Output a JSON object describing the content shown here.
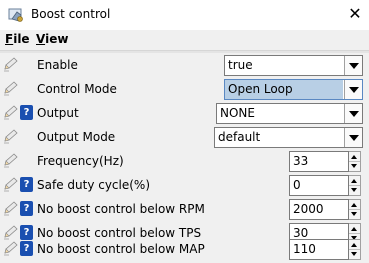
{
  "window": {
    "title": "Boost control",
    "close_glyph": "✕",
    "app_icon": "boost-control-icon"
  },
  "menu": {
    "file": {
      "mnemonic": "F",
      "rest": "ile"
    },
    "view": {
      "mnemonic": "V",
      "rest": "iew"
    }
  },
  "fields": {
    "enable": {
      "label": "Enable",
      "value": "true"
    },
    "control_mode": {
      "label": "Control Mode",
      "value": "Open Loop"
    },
    "output": {
      "label": "Output",
      "value": "NONE"
    },
    "output_mode": {
      "label": "Output Mode",
      "value": "default"
    },
    "frequency": {
      "label": "Frequency(Hz)",
      "value": "33"
    },
    "safe_duty": {
      "label": "Safe duty cycle(%)",
      "value": "0"
    },
    "below_rpm": {
      "label": "No boost control below RPM",
      "value": "2000"
    },
    "below_tps": {
      "label": "No boost control below TPS",
      "value": "30"
    },
    "below_map": {
      "label": "No boost control below MAP",
      "value": "110"
    }
  },
  "help_glyph": "?",
  "icons": {
    "edit": "pencil-icon",
    "help": "help-icon"
  }
}
